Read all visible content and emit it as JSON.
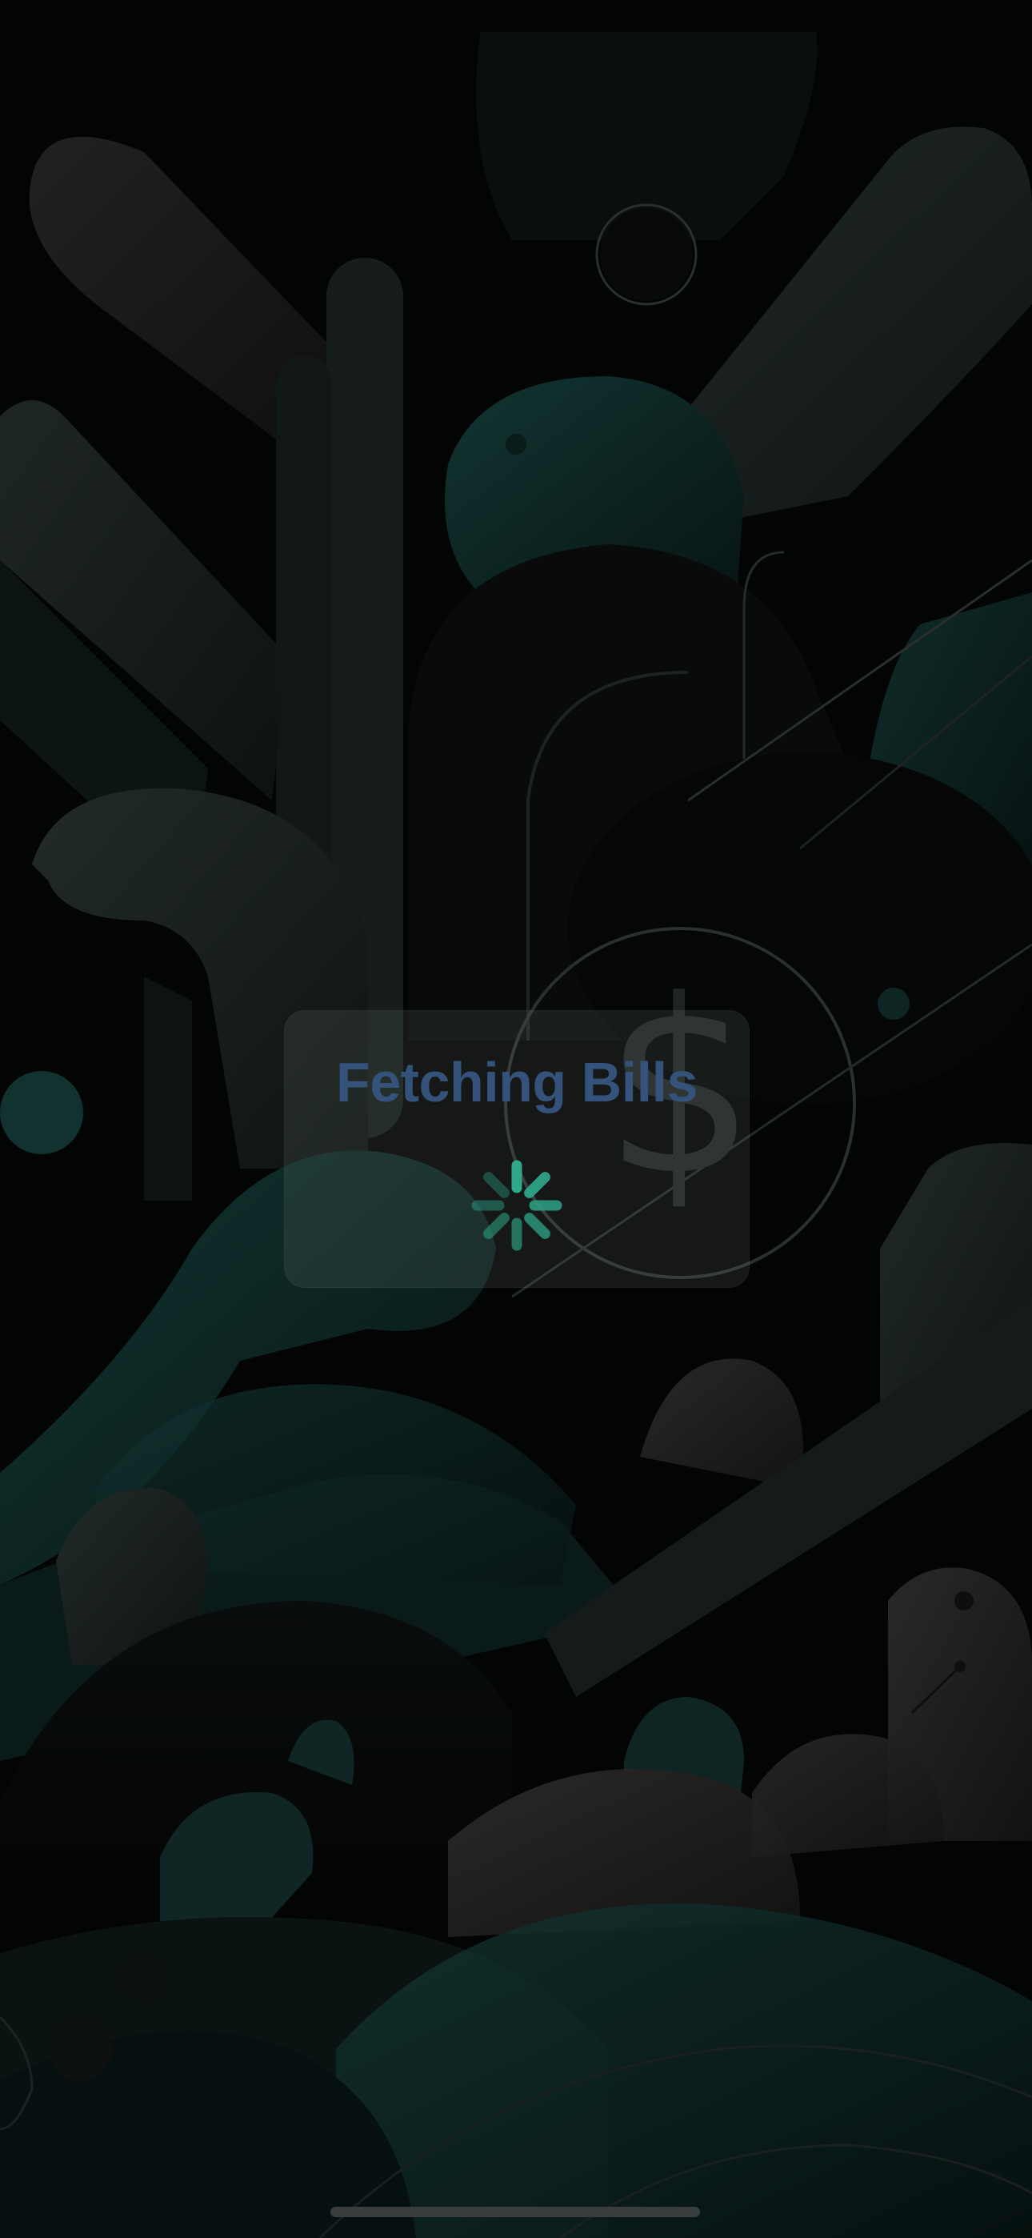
{
  "loading": {
    "title": "Fetching Bills",
    "title_color": "#34527a",
    "spinner_color": "#2fa88a"
  },
  "background": {
    "icon": "dollar-sign-icon",
    "palette": {
      "base": "#030404",
      "dark_teal": "#0b1d1c",
      "teal": "#123431",
      "slate": "#1c2523",
      "warm_gray": "#262524"
    }
  },
  "system": {
    "home_indicator": "home-indicator"
  }
}
